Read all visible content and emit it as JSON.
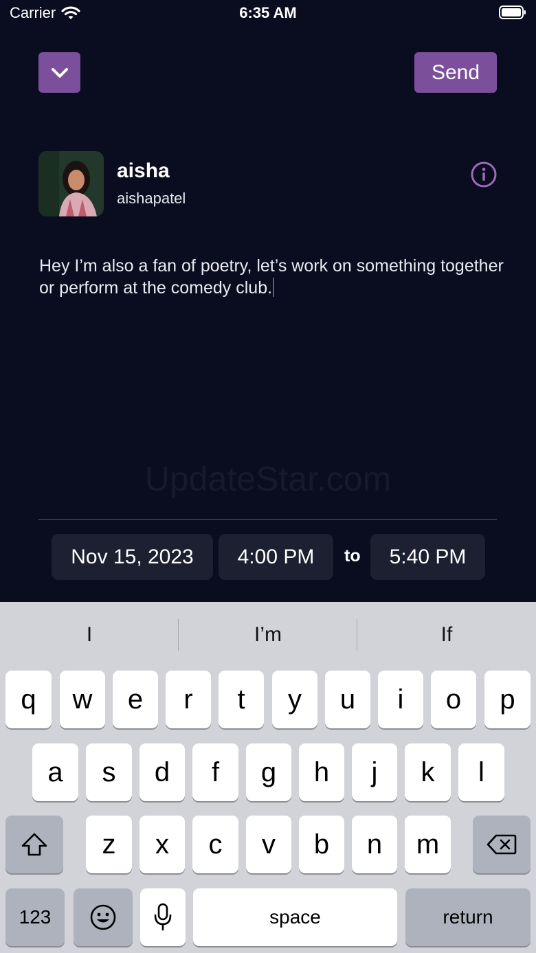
{
  "status_bar": {
    "carrier": "Carrier",
    "time": "6:35 AM"
  },
  "header": {
    "send_label": "Send"
  },
  "profile": {
    "name": "aisha",
    "handle": "aishapatel"
  },
  "message": {
    "text": "Hey I’m also a fan of poetry, let’s work on something together or perform at the comedy club."
  },
  "watermark": "UpdateStar.com",
  "schedule": {
    "date": "Nov 15, 2023",
    "start_time": "4:00 PM",
    "to_label": "to",
    "end_time": "5:40 PM"
  },
  "keyboard": {
    "suggestions": [
      "I",
      "I’m",
      "If"
    ],
    "row1": [
      "q",
      "w",
      "e",
      "r",
      "t",
      "y",
      "u",
      "i",
      "o",
      "p"
    ],
    "row2": [
      "a",
      "s",
      "d",
      "f",
      "g",
      "h",
      "j",
      "k",
      "l"
    ],
    "row3": [
      "z",
      "x",
      "c",
      "v",
      "b",
      "n",
      "m"
    ],
    "numbers_label": "123",
    "space_label": "space",
    "return_label": "return"
  },
  "colors": {
    "accent": "#7b4f9c",
    "background": "#0a0d1f",
    "pill": "#1c2031"
  },
  "icons": [
    "wifi-icon",
    "battery-icon",
    "chevron-down-icon",
    "info-icon",
    "shift-icon",
    "delete-icon",
    "emoji-icon",
    "microphone-icon"
  ]
}
